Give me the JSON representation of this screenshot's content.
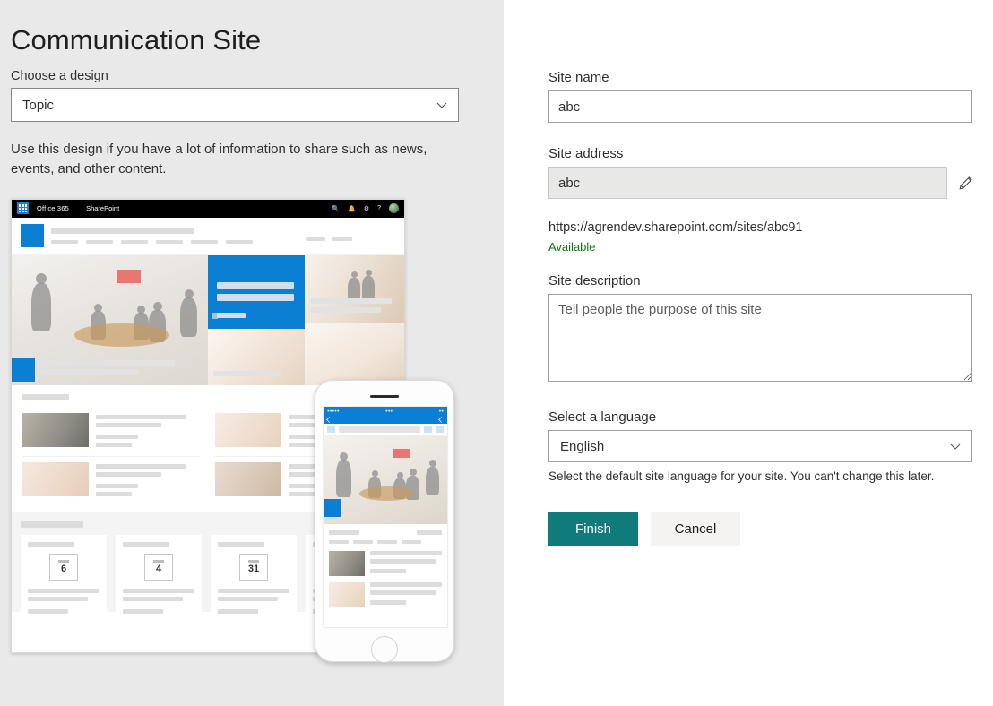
{
  "left": {
    "title": "Communication Site",
    "design_label": "Choose a design",
    "design_value": "Topic",
    "design_description": "Use this design if you have a lot of information to share such as news, events, and other content.",
    "chevron_icon": "chevron-down-icon"
  },
  "preview": {
    "suite": {
      "waffle_icon": "waffle-icon",
      "brand": "Office 365",
      "app": "SharePoint",
      "search_icon": "search-icon",
      "settings_icon": "gear-icon",
      "notifications_icon": "bell-icon",
      "help_icon": "help-icon",
      "avatar_icon": "avatar"
    },
    "events": {
      "dates": [
        "6",
        "4",
        "31"
      ]
    }
  },
  "form": {
    "site_name_label": "Site name",
    "site_name_value": "abc",
    "site_name_placeholder": "",
    "site_address_label": "Site address",
    "site_address_value": "abc",
    "site_address_placeholder": "",
    "edit_icon": "pencil-icon",
    "url": "https://agrendev.sharepoint.com/sites/abc91",
    "availability": "Available",
    "availability_color": "#107c10",
    "description_label": "Site description",
    "description_value": "",
    "description_placeholder": "Tell people the purpose of this site",
    "language_label": "Select a language",
    "language_value": "English",
    "language_hint": "Select the default site language for your site. You can't change this later.",
    "language_chevron_icon": "chevron-down-icon"
  },
  "actions": {
    "finish_label": "Finish",
    "cancel_label": "Cancel",
    "finish_color": "#0f7b7b"
  }
}
